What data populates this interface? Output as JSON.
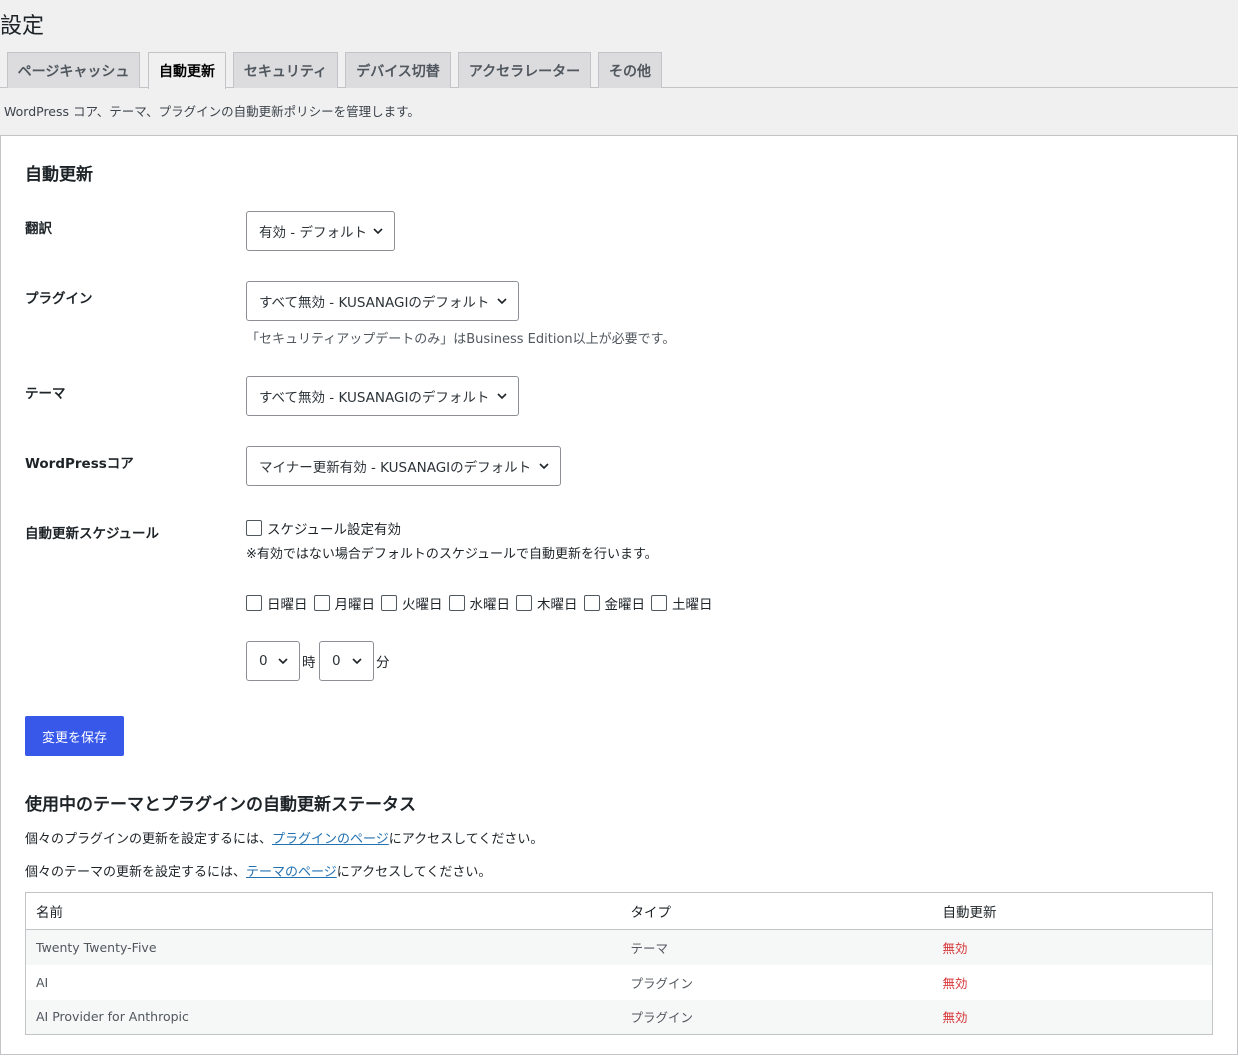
{
  "page": {
    "title": "設定",
    "description": "WordPress コア、テーマ、プラグインの自動更新ポリシーを管理します。"
  },
  "tabs": [
    {
      "label": "ページキャッシュ"
    },
    {
      "label": "自動更新",
      "active": true
    },
    {
      "label": "セキュリティ"
    },
    {
      "label": "デバイス切替"
    },
    {
      "label": "アクセラレーター"
    },
    {
      "label": "その他"
    }
  ],
  "auto_update": {
    "section_title": "自動更新",
    "translation": {
      "label": "翻訳",
      "value": "有効 - デフォルト"
    },
    "plugins": {
      "label": "プラグイン",
      "value": "すべて無効 - KUSANAGIのデフォルト",
      "note": "「セキュリティアップデートのみ」はBusiness Edition以上が必要です。"
    },
    "themes": {
      "label": "テーマ",
      "value": "すべて無効 - KUSANAGIのデフォルト"
    },
    "core": {
      "label": "WordPressコア",
      "value": "マイナー更新有効 - KUSANAGIのデフォルト"
    },
    "schedule": {
      "label": "自動更新スケジュール",
      "enable_label": "スケジュール設定有効",
      "enable_note": "※有効ではない場合デフォルトのスケジュールで自動更新を行います。",
      "days": [
        "日曜日",
        "月曜日",
        "火曜日",
        "水曜日",
        "木曜日",
        "金曜日",
        "土曜日"
      ],
      "hour_value": "0",
      "hour_unit": "時",
      "minute_value": "0",
      "minute_unit": "分"
    },
    "save_label": "変更を保存"
  },
  "status": {
    "section_title": "使用中のテーマとプラグインの自動更新ステータス",
    "plugin_text_before": "個々のプラグインの更新を設定するには、",
    "plugin_link": "プラグインのページ",
    "plugin_text_after": "にアクセスしてください。",
    "theme_text_before": "個々のテーマの更新を設定するには、",
    "theme_link": "テーマのページ",
    "theme_text_after": "にアクセスしてください。",
    "columns": [
      "名前",
      "タイプ",
      "自動更新"
    ],
    "rows": [
      {
        "name": "Twenty Twenty-Five",
        "type": "テーマ",
        "auto": "無効"
      },
      {
        "name": "AI",
        "type": "プラグイン",
        "auto": "無効"
      },
      {
        "name": "AI Provider for Anthropic",
        "type": "プラグイン",
        "auto": "無効"
      }
    ],
    "disabled_color": "#d63638"
  },
  "colors": {
    "primary_button": "#3858e9",
    "link": "#2271b1"
  }
}
